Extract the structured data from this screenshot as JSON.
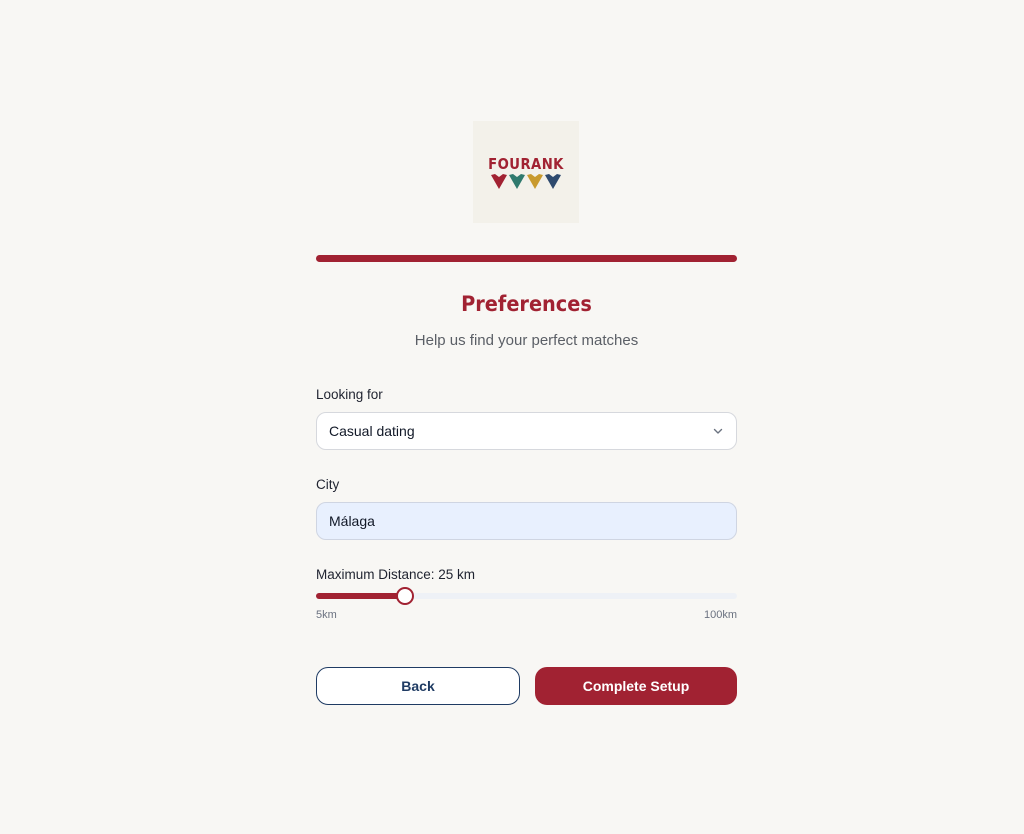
{
  "logo": {
    "text": "FOURANK",
    "heart_colors": [
      "#a12232",
      "#2f7a6e",
      "#c89a2e",
      "#2e4a6e"
    ]
  },
  "progress": {
    "percent": 100
  },
  "header": {
    "title": "Preferences",
    "subtitle": "Help us find your perfect matches"
  },
  "form": {
    "looking_for": {
      "label": "Looking for",
      "value": "Casual dating",
      "icon": "chevron-down-icon"
    },
    "city": {
      "label": "City",
      "value": "Málaga"
    },
    "distance": {
      "label": "Maximum Distance: 25 km",
      "min_label": "5km",
      "max_label": "100km",
      "min": 5,
      "max": 100,
      "value": 25
    }
  },
  "actions": {
    "back_label": "Back",
    "complete_label": "Complete Setup"
  },
  "colors": {
    "brand": "#a12232",
    "secondary": "#1f3b63",
    "background": "#f8f7f4"
  }
}
